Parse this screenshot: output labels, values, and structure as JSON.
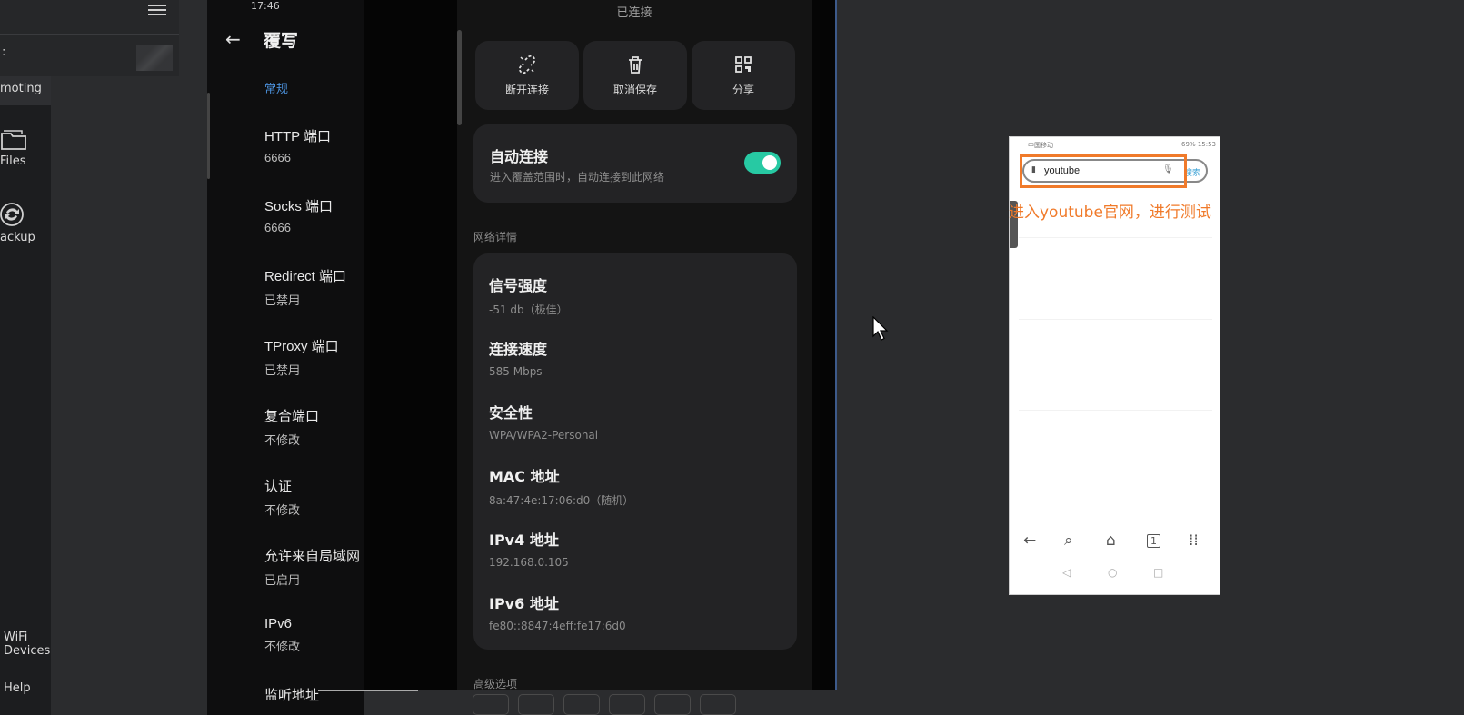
{
  "sidebar": {
    "top_colon": ":",
    "items": [
      {
        "label": "moting"
      },
      {
        "label": "Files"
      },
      {
        "label": "ackup"
      },
      {
        "label_line1": "WiFi",
        "label_line2": "Devices"
      },
      {
        "label": "Help"
      }
    ]
  },
  "settings_panel": {
    "status_time": "17:46",
    "title": "覆写",
    "section": "常规",
    "items": [
      {
        "title": "HTTP 端口",
        "value": "6666"
      },
      {
        "title": "Socks 端口",
        "value": "6666"
      },
      {
        "title": "Redirect 端口",
        "value": "已禁用"
      },
      {
        "title": "TProxy 端口",
        "value": "已禁用"
      },
      {
        "title": "复合端口",
        "value": "不修改"
      },
      {
        "title": "认证",
        "value": "不修改"
      },
      {
        "title": "允许来自局域网",
        "value": "已启用"
      },
      {
        "title": "IPv6",
        "value": "不修改"
      },
      {
        "title": "监听地址",
        "value": ""
      }
    ]
  },
  "wifi": {
    "status": "已连接",
    "actions": [
      {
        "label": "断开连接",
        "icon": "unlink-icon"
      },
      {
        "label": "取消保存",
        "icon": "trash-icon"
      },
      {
        "label": "分享",
        "icon": "qr-icon"
      }
    ],
    "auto_connect": {
      "title": "自动连接",
      "subtitle": "进入覆盖范围时，自动连接到此网络",
      "enabled": true
    },
    "details_label": "网络详情",
    "details": [
      {
        "title": "信号强度",
        "value": "-51 db（极佳）"
      },
      {
        "title": "连接速度",
        "value": "585 Mbps"
      },
      {
        "title": "安全性",
        "value": "WPA/WPA2-Personal"
      },
      {
        "title": "MAC 地址",
        "value": "8a:47:4e:17:06:d0（随机）"
      },
      {
        "title": "IPv4 地址",
        "value": "192.168.0.105"
      },
      {
        "title": "IPv6 地址",
        "value": "fe80::8847:4eff:fe17:6d0"
      }
    ],
    "advanced_label": "高级选项",
    "accent": "#27c9a3"
  },
  "mini_phone": {
    "status_left": "中国移动",
    "status_right": "69% 15:53",
    "search_query": "youtube",
    "search_button": "搜索",
    "nav": [
      "back-icon",
      "search-icon",
      "home-icon",
      "tabs-icon",
      "menu-icon"
    ],
    "tab_count": "1"
  },
  "annotation": {
    "text": "进入youtube官网，进行测试",
    "color": "#f07a2a"
  }
}
